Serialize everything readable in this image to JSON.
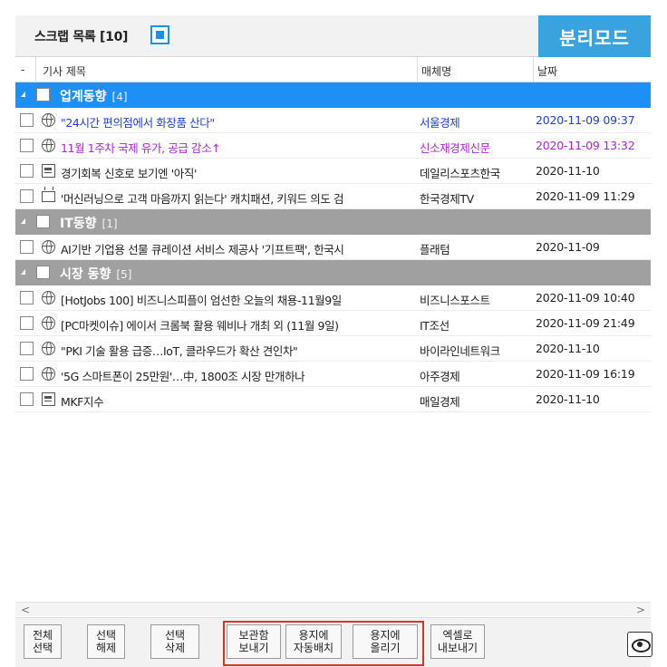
{
  "header": {
    "title": "스크랩 목록 [10]",
    "mode_button": "분리모드"
  },
  "columns": {
    "dash": "-",
    "title": "기사 제목",
    "media": "매체명",
    "date": "날짜"
  },
  "groups": [
    {
      "name": "업계동향",
      "count": "[4]",
      "items": [
        {
          "icon": "globe-icon",
          "title": "\"24시간 편의점에서 화장품 산다\"",
          "media": "서울경제",
          "date": "2020-11-09 09:37",
          "color": "#1f3fd1"
        },
        {
          "icon": "globe-icon",
          "title": "11월 1주차 국제 유가, 공급 감소↑",
          "media": "신소재경제신문",
          "date": "2020-11-09 13:32",
          "color": "#b024d8"
        },
        {
          "icon": "document-icon",
          "title": "경기회복 신호로 보기엔 '아직'",
          "media": "데일리스포츠한국",
          "date": "2020-11-10",
          "color": "#222222"
        },
        {
          "icon": "tv-icon",
          "title": "'머신러닝으로 고객 마음까지 읽는다' 캐치패션, 키워드 의도 검",
          "media": "한국경제TV",
          "date": "2020-11-09 11:29",
          "color": "#222222"
        }
      ]
    },
    {
      "name": "IT동향",
      "count": "[1]",
      "items": [
        {
          "icon": "globe-icon",
          "title": "AI기반 기업용 선물 큐레이션 서비스 제공사 '기프트팩', 한국시",
          "media": "플래텀",
          "date": "2020-11-09",
          "color": "#222222"
        }
      ]
    },
    {
      "name": "시장 동향",
      "count": "[5]",
      "items": [
        {
          "icon": "globe-icon",
          "title": "[HotJobs 100] 비즈니스피플이 엄선한 오늘의 채용-11월9일",
          "media": "비즈니스포스트",
          "date": "2020-11-09 10:40",
          "color": "#222222"
        },
        {
          "icon": "globe-icon",
          "title": "[PC마켓이슈] 에이서 크롬북 활용 웨비나 개최 외 (11월 9일)",
          "media": "IT조선",
          "date": "2020-11-09 21:49",
          "color": "#222222"
        },
        {
          "icon": "globe-icon",
          "title": "\"PKI 기술 활용 급증…IoT, 클라우드가 확산 견인차\"",
          "media": "바이라인네트워크",
          "date": "2020-11-10",
          "color": "#222222"
        },
        {
          "icon": "globe-icon",
          "title": "'5G 스마트폰이 25만원'…中, 1800조 시장 만개하나",
          "media": "아주경제",
          "date": "2020-11-09 16:19",
          "color": "#222222"
        },
        {
          "icon": "document-icon",
          "title": "MKF지수",
          "media": "매일경제",
          "date": "2020-11-10",
          "color": "#222222"
        }
      ]
    }
  ],
  "scrollbar": {
    "left": "<",
    "right": ">"
  },
  "footer": {
    "buttons": [
      {
        "name": "select-all-button",
        "label": "전체\n선택"
      },
      {
        "name": "deselect-button",
        "label": "선택\n해제"
      },
      {
        "name": "delete-selected-button",
        "label": "선택\n삭제"
      },
      {
        "name": "send-to-archive-button",
        "label": "보관함\n보내기"
      },
      {
        "name": "auto-layout-button",
        "label": "용지에\n자동배치"
      },
      {
        "name": "upload-to-paper-button",
        "label": "용지에\n올리기"
      },
      {
        "name": "export-excel-button",
        "label": "엑셀로\n내보내기"
      }
    ],
    "eye_icon": "eye-icon"
  }
}
